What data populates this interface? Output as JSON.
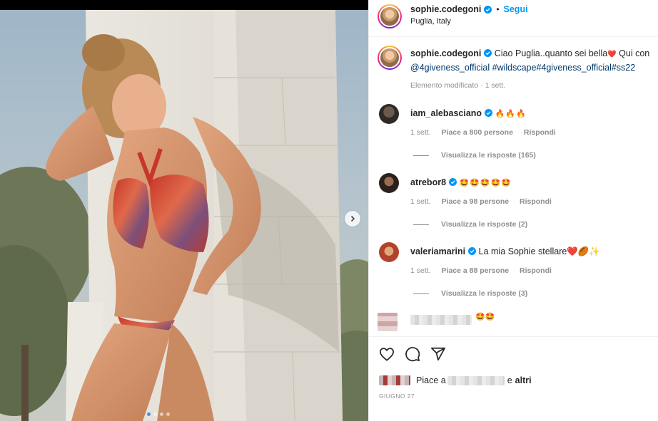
{
  "post": {
    "author": "sophie.codegoni",
    "location": "Puglia, Italy",
    "follow_label": "Segui",
    "separator": "•"
  },
  "caption": {
    "author": "sophie.codegoni",
    "text_1": "Ciao Puglia..quanto sei bella",
    "heart": "❤️",
    "text_2": " Qui con",
    "mention": "@4giveness_official",
    "hashtags": " #wildscape#4giveness_official#ss22",
    "edited_label": "Elemento modificato",
    "dot": "·",
    "time": "1 sett."
  },
  "comments": [
    {
      "user": "iam_alebasciano",
      "text": "🔥🔥🔥",
      "time": "1 sett.",
      "likes": "Piace a 800 persone",
      "reply": "Rispondi",
      "replies": "Visualizza le risposte (165)"
    },
    {
      "user": "atrebor8",
      "text": "🤩🤩🤩🤩🤩",
      "time": "1 sett.",
      "likes": "Piace a 98 persone",
      "reply": "Rispondi",
      "replies": "Visualizza le risposte (2)"
    },
    {
      "user": "valeriamarini",
      "text": "La mia Sophie stellare❤️🏉✨",
      "time": "1 sett.",
      "likes": "Piace a 88 persone",
      "reply": "Rispondi",
      "replies": "Visualizza le risposte (3)"
    }
  ],
  "last_comment": {
    "text": "🤩🤩"
  },
  "liked_by": {
    "prefix": "Piace a",
    "suffix": "e",
    "others": "altri"
  },
  "post_date": "GIUGNO 27",
  "carousel": {
    "slides": 4,
    "active_index": 0
  },
  "icons": [
    "verified-badge-icon",
    "chevron-right-icon",
    "heart-icon",
    "comment-icon",
    "share-icon"
  ],
  "colors": {
    "link": "#00376b",
    "follow": "#0095f6",
    "verified": "#0095f6",
    "muted": "#8e8e8e"
  }
}
